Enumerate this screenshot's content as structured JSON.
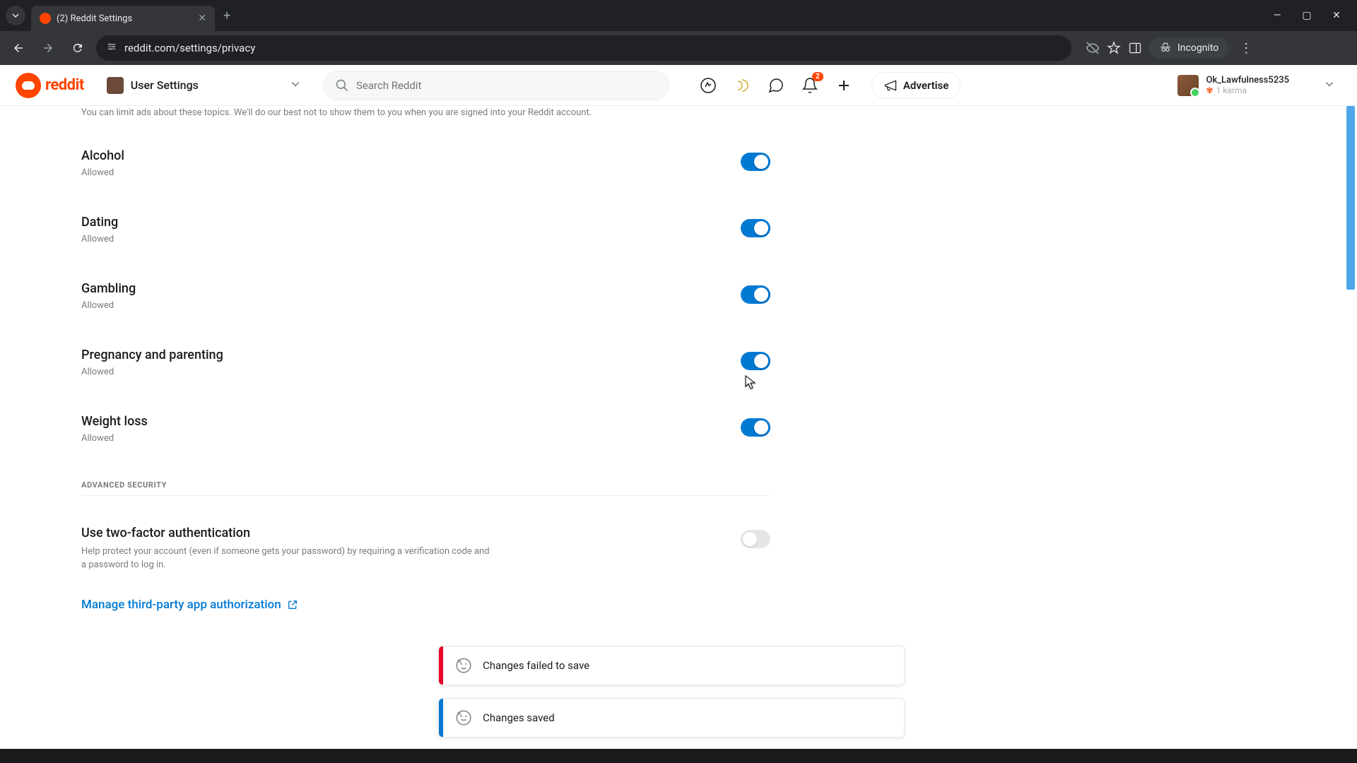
{
  "browser": {
    "tab_title": "(2) Reddit Settings",
    "url": "reddit.com/settings/privacy",
    "incognito_label": "Incognito"
  },
  "header": {
    "brand": "reddit",
    "context_label": "User Settings",
    "search_placeholder": "Search Reddit",
    "notification_badge": "2",
    "advertise_label": "Advertise",
    "user": {
      "name": "Ok_Lawfulness5235",
      "karma": "1 karma"
    }
  },
  "settings": {
    "sensitive_ads_note": "You can limit ads about these topics. We'll do our best not to show them to you when you are signed into your Reddit account.",
    "topics": [
      {
        "title": "Alcohol",
        "status": "Allowed",
        "on": true
      },
      {
        "title": "Dating",
        "status": "Allowed",
        "on": true
      },
      {
        "title": "Gambling",
        "status": "Allowed",
        "on": true
      },
      {
        "title": "Pregnancy and parenting",
        "status": "Allowed",
        "on": true
      },
      {
        "title": "Weight loss",
        "status": "Allowed",
        "on": true
      }
    ],
    "advanced_security_header": "ADVANCED SECURITY",
    "twofa": {
      "title": "Use two-factor authentication",
      "desc": "Help protect your account (even if someone gets your password) by requiring a verification code and a password to log in.",
      "on": false
    },
    "manage_apps_label": "Manage third-party app authorization"
  },
  "toasts": {
    "error": "Changes failed to save",
    "success": "Changes saved"
  }
}
